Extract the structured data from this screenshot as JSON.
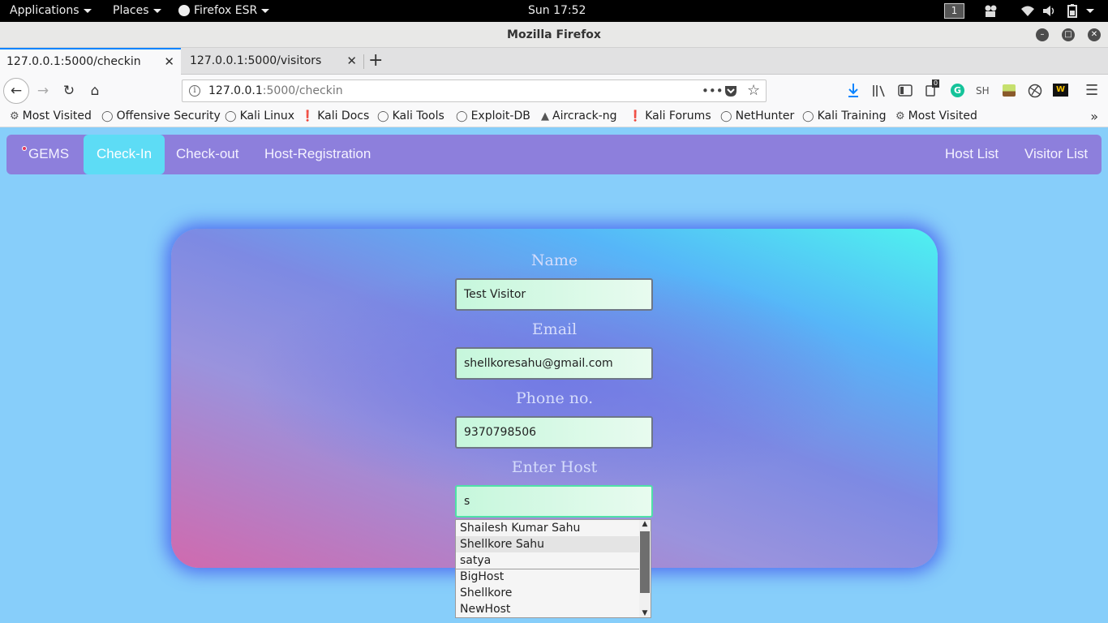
{
  "panel": {
    "applications": "Applications",
    "places": "Places",
    "browser": "Firefox ESR",
    "clock": "Sun 17:52",
    "workspace": "1"
  },
  "window": {
    "title": "Mozilla Firefox"
  },
  "tabs": [
    {
      "label": "127.0.0.1:5000/checkin"
    },
    {
      "label": "127.0.0.1:5000/visitors"
    }
  ],
  "urlbar": {
    "host": "127.0.0.1",
    "path": ":5000/checkin"
  },
  "toolbar": {
    "sh_label": "SH",
    "badge": "0"
  },
  "bookmarks": [
    "Most Visited",
    "Offensive Security",
    "Kali Linux",
    "Kali Docs",
    "Kali Tools",
    "Exploit-DB",
    "Aircrack-ng",
    "Kali Forums",
    "NetHunter",
    "Kali Training",
    "Most Visited"
  ],
  "appnav": {
    "brand": "GEMS",
    "checkin": "Check-In",
    "checkout": "Check-out",
    "host_registration": "Host-Registration",
    "host_list": "Host List",
    "visitor_list": "Visitor List"
  },
  "form": {
    "name_label": "Name",
    "name_value": "Test Visitor",
    "email_label": "Email",
    "email_value": "shellkoresahu@gmail.com",
    "phone_label": "Phone no.",
    "phone_value": "9370798506",
    "host_label": "Enter Host",
    "host_value": "s"
  },
  "suggestions": {
    "history": [
      "Shailesh Kumar Sahu",
      "Shellkore Sahu",
      "satya"
    ],
    "options": [
      "BigHost",
      "Shellkore",
      "NewHost"
    ]
  }
}
